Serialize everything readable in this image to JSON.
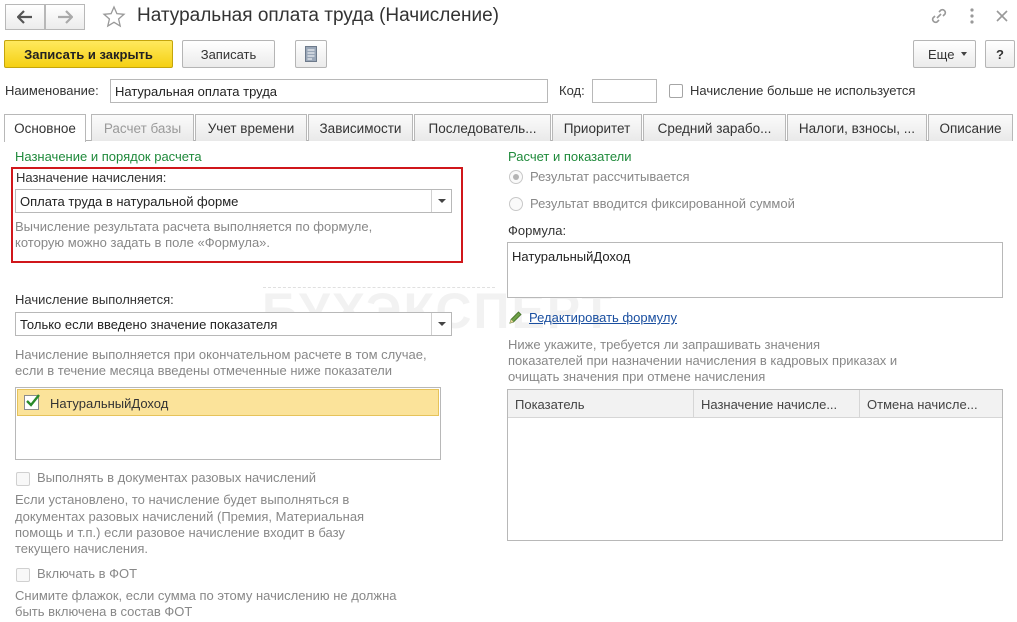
{
  "window": {
    "title": "Натуральная оплата труда (Начисление)"
  },
  "toolbar": {
    "save_close_label": "Записать и закрыть",
    "save_label": "Записать",
    "more_label": "Еще",
    "help_label": "?"
  },
  "header": {
    "name_label": "Наименование:",
    "name_value": "Натуральная оплата труда",
    "code_label": "Код:",
    "code_value": "",
    "unused_label": "Начисление больше не используется"
  },
  "tabs": [
    {
      "label": "Основное",
      "active": true
    },
    {
      "label": "Расчет базы",
      "disabled": true
    },
    {
      "label": "Учет времени"
    },
    {
      "label": "Зависимости"
    },
    {
      "label": "Последователь..."
    },
    {
      "label": "Приоритет"
    },
    {
      "label": "Средний зарабо..."
    },
    {
      "label": "Налоги, взносы, ..."
    },
    {
      "label": "Описание"
    }
  ],
  "left": {
    "section_title": "Назначение и порядок расчета",
    "purpose_label": "Назначение начисления:",
    "purpose_value": "Оплата труда в натуральной форме",
    "purpose_hint_1": "Вычисление результата расчета выполняется по формуле,",
    "purpose_hint_2": "которую можно задать в поле «Формула».",
    "exec_label": "Начисление выполняется:",
    "exec_value": "Только если введено значение показателя",
    "exec_hint_1": "Начисление выполняется при окончательном расчете в том случае,",
    "exec_hint_2": "если в течение месяца введены отмеченные ниже показатели",
    "indicator_item": "НатуральныйДоход",
    "one_time_label": "Выполнять в документах разовых начислений",
    "one_time_hint_1": "Если установлено, то начисление будет выполняться в",
    "one_time_hint_2": "документах разовых начислений (Премия, Материальная",
    "one_time_hint_3": "помощь и т.п.) если разовое начисление входит в базу",
    "one_time_hint_4": "текущего начисления.",
    "fot_label": "Включать в ФОТ",
    "fot_hint_1": "Снимите флажок, если сумма по этому начислению не должна",
    "fot_hint_2": "быть включена в состав ФОТ"
  },
  "right": {
    "section_title": "Расчет и показатели",
    "radio_calculated": "Результат рассчитывается",
    "radio_fixed": "Результат вводится фиксированной суммой",
    "formula_label": "Формула:",
    "formula_value": "НатуральныйДоход",
    "edit_formula_link": "Редактировать формулу",
    "indicators_hint_1": "Ниже укажите, требуется ли запрашивать значения",
    "indicators_hint_2": "показателей при назначении начисления в кадровых приказах и",
    "indicators_hint_3": "очищать значения при отмене начисления",
    "grid_columns": [
      "Показатель",
      "Назначение начисле...",
      "Отмена начисле..."
    ]
  },
  "watermark": "БУХЭКСПЕРТ",
  "colors": {
    "accent_yellow": "#f5d013",
    "section_green": "#1f8a3b",
    "highlight_red": "#d0171b",
    "link_blue": "#1a4fa0",
    "selected_row": "#fbe39a"
  }
}
